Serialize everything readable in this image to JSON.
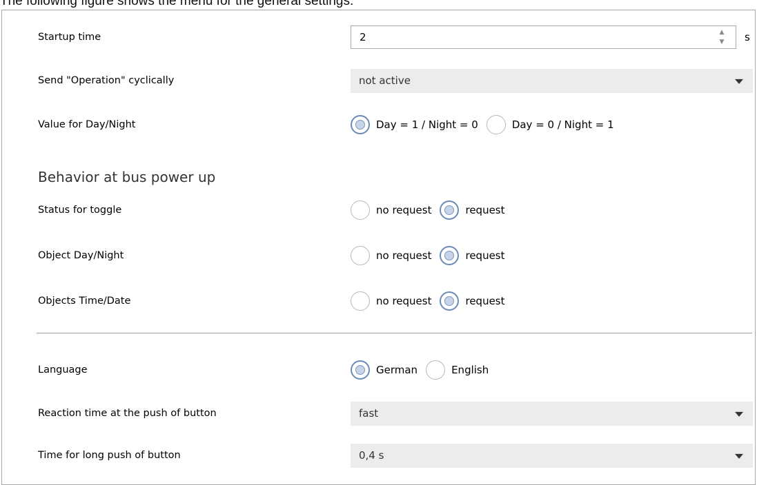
{
  "caption": "The following figure shows the menu for the general settings:",
  "startup_time": {
    "label": "Startup time",
    "value": "2",
    "unit": "s"
  },
  "send_operation": {
    "label": "Send \"Operation\" cyclically",
    "value": "not active"
  },
  "day_night_value": {
    "label": "Value for Day/Night",
    "options": [
      "Day = 1 / Night = 0",
      "Day = 0 / Night = 1"
    ],
    "selected": 0
  },
  "section": {
    "title": "Behavior at bus power up"
  },
  "status_toggle": {
    "label": "Status for toggle",
    "options": [
      "no request",
      "request"
    ],
    "selected": 1
  },
  "object_day_night": {
    "label": "Object Day/Night",
    "options": [
      "no request",
      "request"
    ],
    "selected": 1
  },
  "objects_time_date": {
    "label": "Objects Time/Date",
    "options": [
      "no request",
      "request"
    ],
    "selected": 1
  },
  "language": {
    "label": "Language",
    "options": [
      "German",
      "English"
    ],
    "selected": 0
  },
  "reaction_time": {
    "label": "Reaction time at the push of button",
    "value": "fast"
  },
  "long_push": {
    "label": "Time for long push of button",
    "value": "0,4 s"
  }
}
